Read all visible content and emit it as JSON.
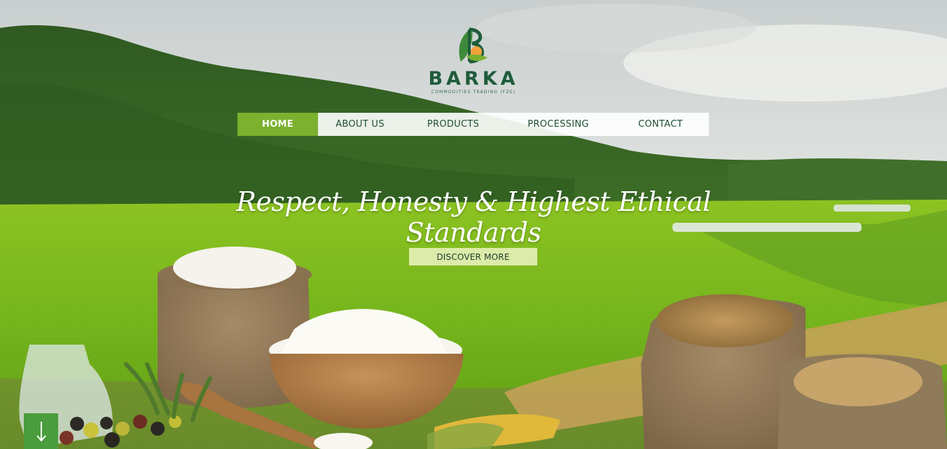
{
  "brand": {
    "name": "BARKA",
    "subtitle": "COMMODITIES TRADING (FZE)",
    "colors": {
      "primary": "#1f5c3b",
      "accent": "#7bb12e"
    }
  },
  "nav": {
    "items": [
      {
        "label": "HOME",
        "active": true
      },
      {
        "label": "ABOUT US",
        "active": false
      },
      {
        "label": "PRODUCTS",
        "active": false
      },
      {
        "label": "PROCESSING",
        "active": false
      },
      {
        "label": "CONTACT",
        "active": false
      }
    ]
  },
  "hero": {
    "tagline": "Respect, Honesty & Highest Ethical Standards",
    "cta_label": "DISCOVER MORE",
    "scroll_icon": "arrow-down-icon"
  }
}
